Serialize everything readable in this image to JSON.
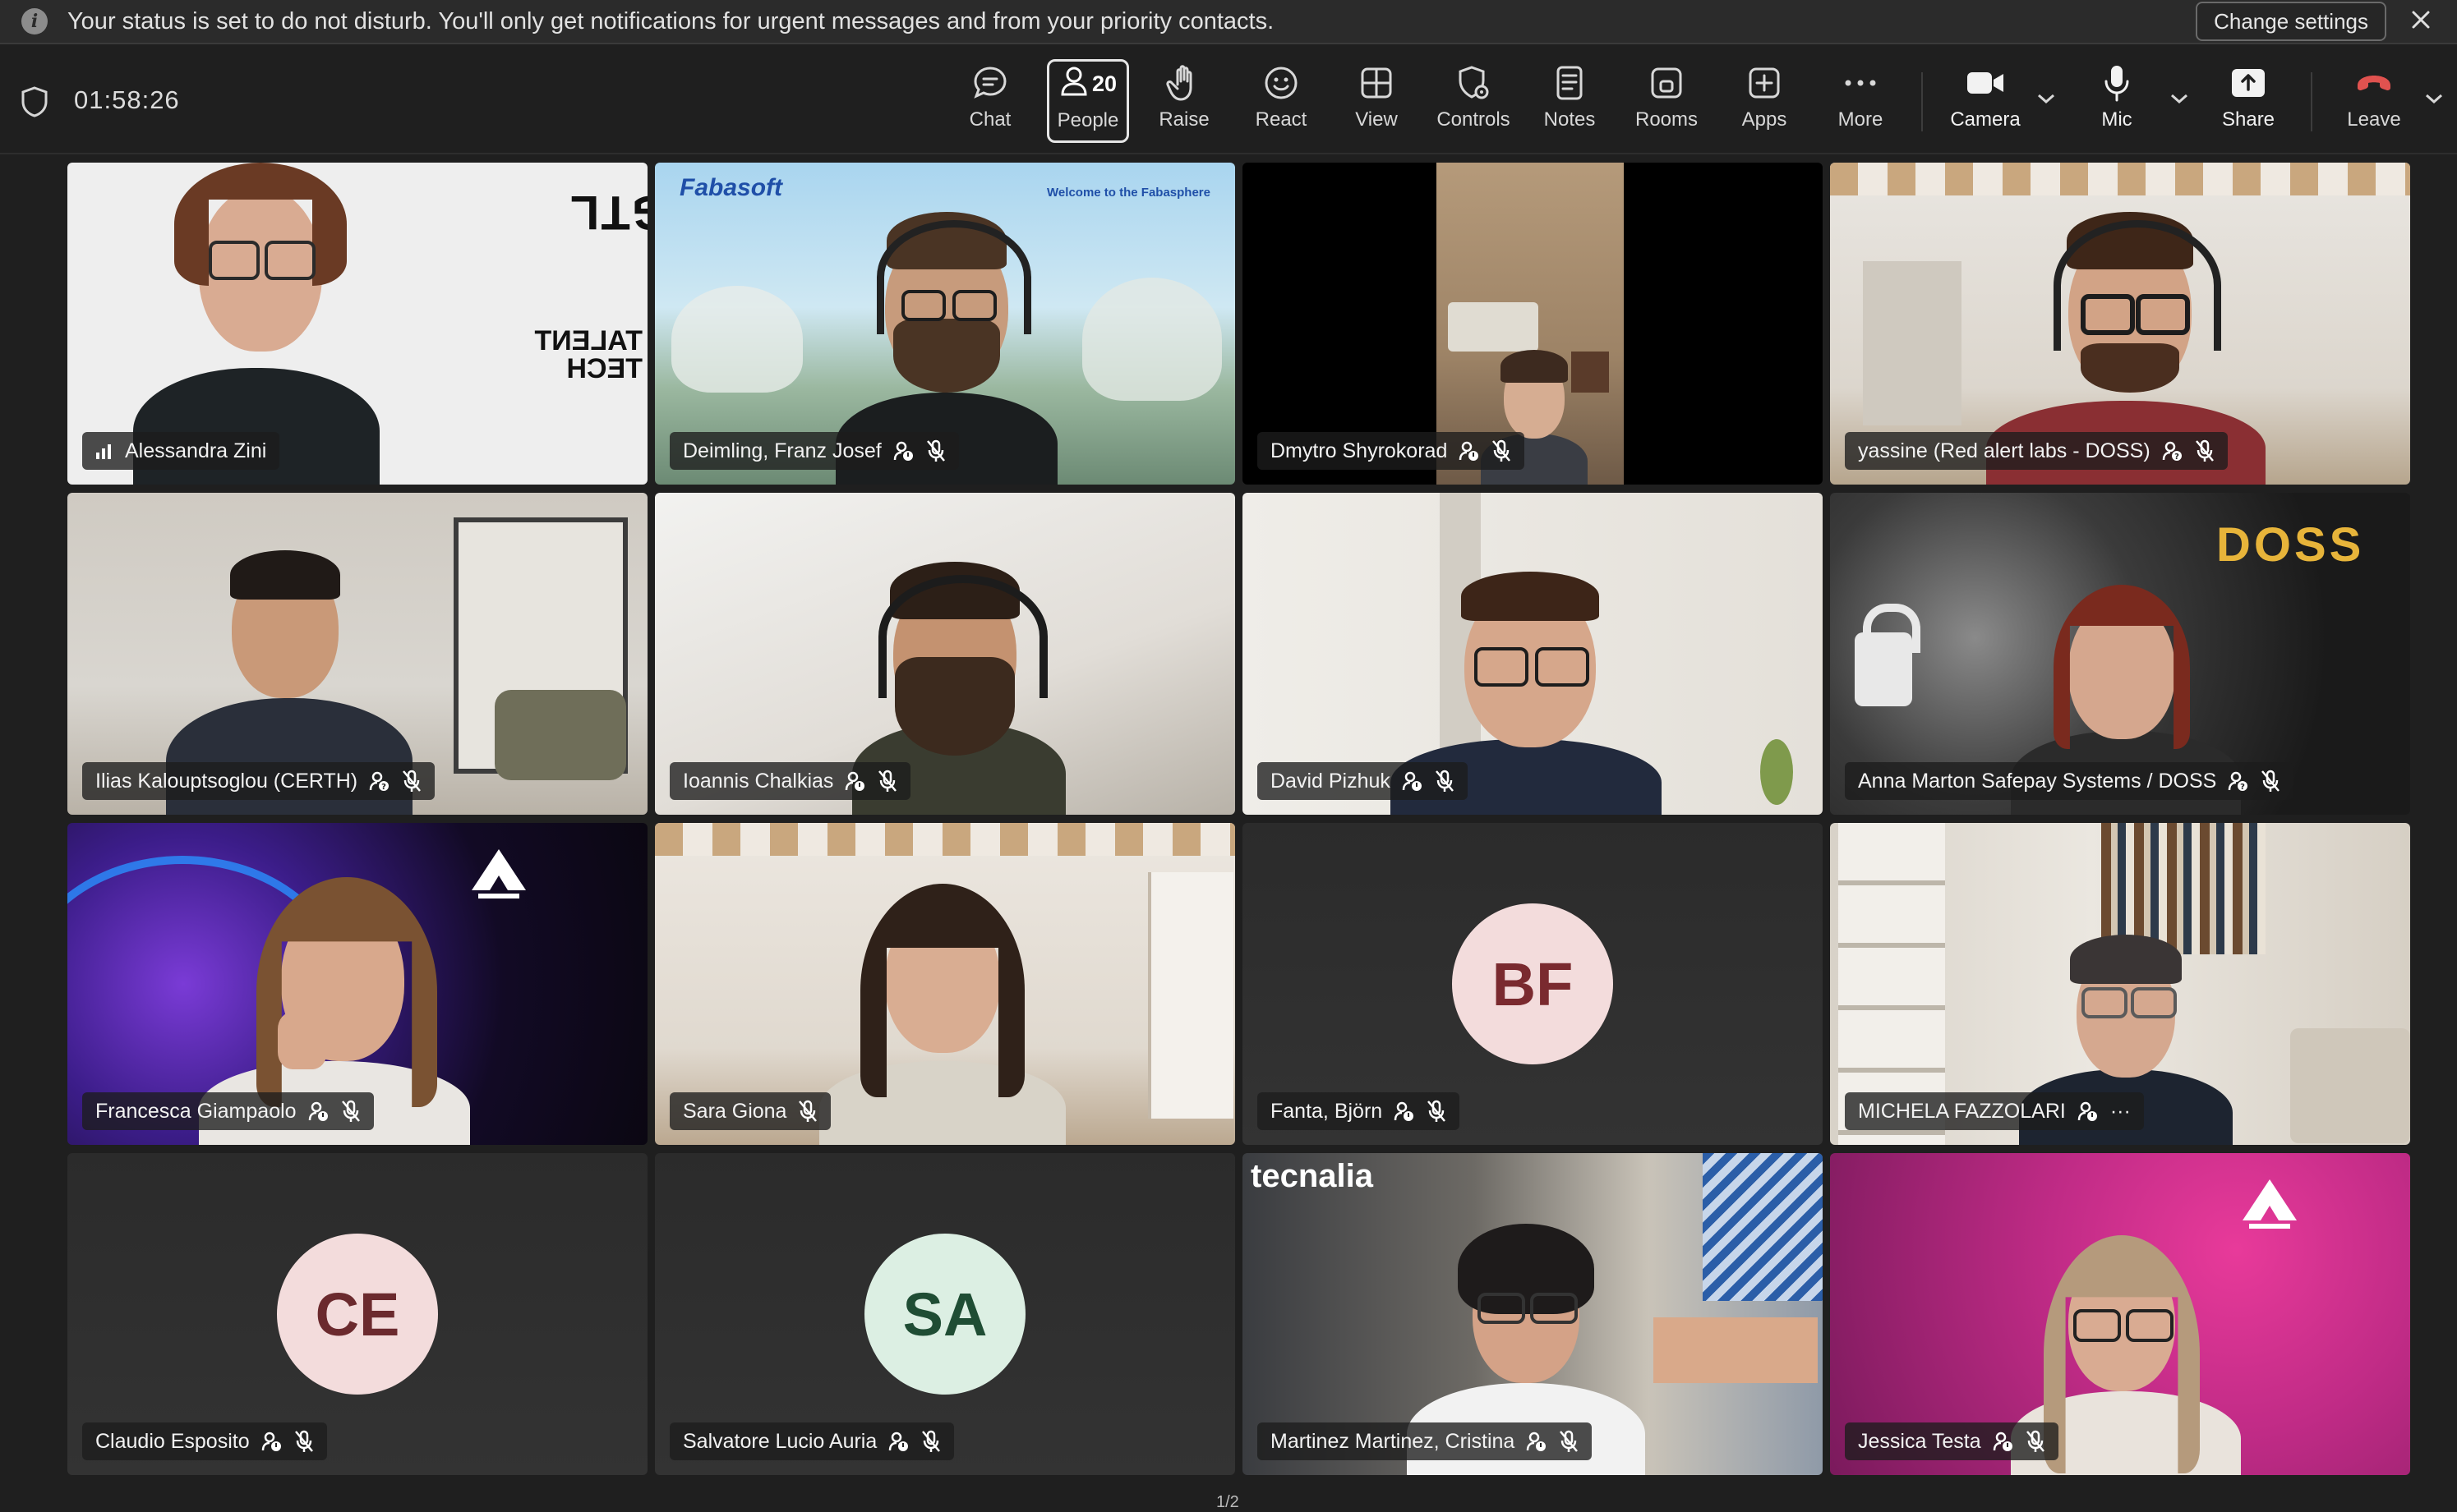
{
  "banner": {
    "message": "Your status is set to do not disturb. You'll only get notifications for urgent messages and from your priority contacts.",
    "change_settings": "Change settings"
  },
  "call": {
    "elapsed": "01:58:26"
  },
  "toolbar": {
    "chat": "Chat",
    "people": "People",
    "people_count": "20",
    "raise": "Raise",
    "react": "React",
    "view": "View",
    "controls": "Controls",
    "notes": "Notes",
    "rooms": "Rooms",
    "apps": "Apps",
    "more": "More",
    "camera": "Camera",
    "mic": "Mic",
    "share": "Share",
    "leave": "Leave"
  },
  "participants": [
    {
      "name": "Alessandra Zini",
      "video": true,
      "speaking": true
    },
    {
      "name": "Deimling, Franz Josef",
      "video": true,
      "muted": true
    },
    {
      "name": "Dmytro Shyrokorad",
      "video": true,
      "muted": true
    },
    {
      "name": "yassine (Red alert labs - DOSS)",
      "video": true,
      "muted": true
    },
    {
      "name": "Ilias Kalouptsoglou (CERTH)",
      "video": true,
      "muted": true
    },
    {
      "name": "Ioannis Chalkias",
      "video": true,
      "muted": true
    },
    {
      "name": "David Pizhuk",
      "video": true,
      "muted": true
    },
    {
      "name": "Anna Marton Safepay Systems / DOSS",
      "video": true,
      "muted": true
    },
    {
      "name": "Francesca Giampaolo",
      "video": true,
      "muted": true
    },
    {
      "name": "Sara Giona",
      "video": true,
      "muted": true
    },
    {
      "name": "Fanta, Björn",
      "video": false,
      "initials": "BF",
      "muted": true
    },
    {
      "name": "MICHELA FAZZOLARI",
      "video": true,
      "more": "···"
    },
    {
      "name": "Claudio Esposito",
      "video": false,
      "initials": "CE",
      "muted": true
    },
    {
      "name": "Salvatore Lucio Auria",
      "video": false,
      "initials": "SA",
      "muted": true
    },
    {
      "name": "Martinez Martinez, Cristina",
      "video": true,
      "muted": true
    },
    {
      "name": "Jessica Testa",
      "video": true,
      "muted": true
    }
  ],
  "backgrounds": {
    "tile1_logo": "DGTL",
    "tile1_text": "TALENT TECH",
    "tile2_logo": "Fabasoft",
    "tile2_banner": "Welcome to the Fabasphere",
    "tile8_logo": "DOSS",
    "tile15_logo": "tecnalia"
  },
  "pager": "1/2",
  "colors": {
    "leave_red": "#e0524f",
    "avatar_bf_bg": "#f3dcdc",
    "avatar_bf_fg": "#7a2a2f",
    "avatar_ce_bg": "#f3dcdc",
    "avatar_ce_fg": "#6b2a2e",
    "avatar_sa_bg": "#dcefe3",
    "avatar_sa_fg": "#1f4d34"
  }
}
